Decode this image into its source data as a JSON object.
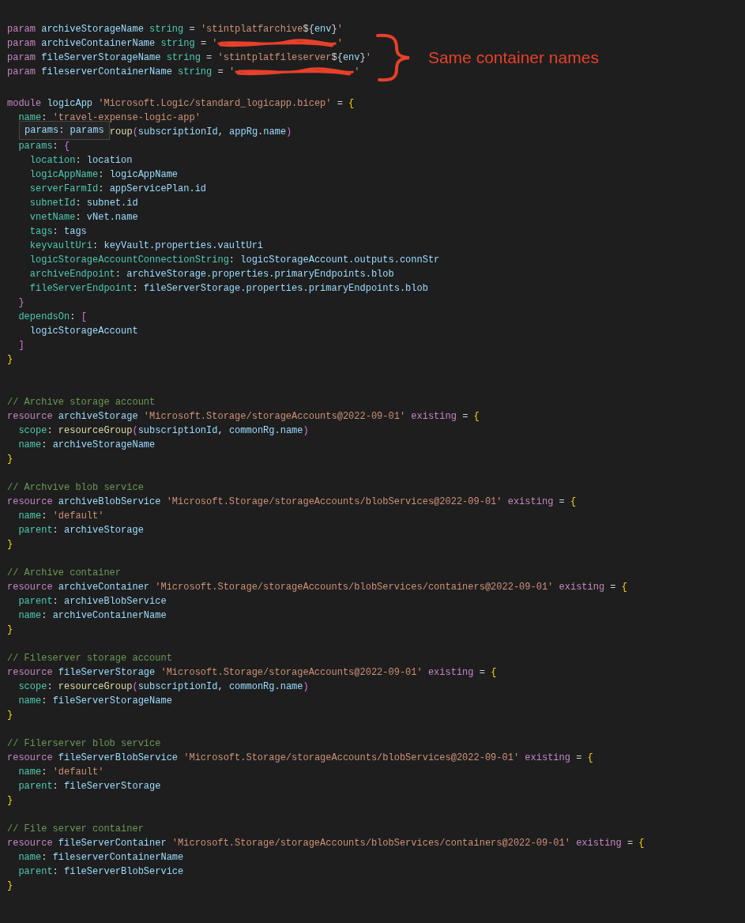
{
  "editor": {
    "blocks": [
      {
        "kind": "none",
        "lines": [
          {
            "tokens": [
              {
                "kind": "kw",
                "text": "param "
              },
              {
                "kind": "id",
                "text": "archiveStorageName "
              },
              {
                "kind": "type",
                "text": "string "
              },
              {
                "kind": "op",
                "text": "= "
              },
              {
                "kind": "str",
                "text": "'stintplatfarchive"
              },
              {
                "kind": "op",
                "text": "${"
              },
              {
                "kind": "id",
                "text": "env"
              },
              {
                "kind": "op",
                "text": "}"
              },
              {
                "kind": "str",
                "text": "'"
              }
            ]
          },
          {
            "tokens": [
              {
                "kind": "kw",
                "text": "param "
              },
              {
                "kind": "id",
                "text": "archiveContainerName "
              },
              {
                "kind": "type",
                "text": "string "
              },
              {
                "kind": "op",
                "text": "= "
              },
              {
                "kind": "str",
                "text": "'"
              },
              {
                "kind": "redacted"
              },
              {
                "kind": "str",
                "text": "'"
              }
            ]
          },
          {
            "tokens": [
              {
                "kind": "kw",
                "text": "param "
              },
              {
                "kind": "id",
                "text": "fileServerStorageName "
              },
              {
                "kind": "type",
                "text": "string "
              },
              {
                "kind": "op",
                "text": "= "
              },
              {
                "kind": "str",
                "text": "'stintplatfileserver"
              },
              {
                "kind": "op",
                "text": "${"
              },
              {
                "kind": "id",
                "text": "env"
              },
              {
                "kind": "op",
                "text": "}"
              },
              {
                "kind": "str",
                "text": "'"
              }
            ]
          },
          {
            "tokens": [
              {
                "kind": "kw",
                "text": "param "
              },
              {
                "kind": "id",
                "text": "fileserverContainerName "
              },
              {
                "kind": "type",
                "text": "string "
              },
              {
                "kind": "op",
                "text": "= "
              },
              {
                "kind": "str",
                "text": "'"
              },
              {
                "kind": "redacted"
              },
              {
                "kind": "str",
                "text": "'"
              }
            ]
          }
        ]
      },
      {
        "kind": "single",
        "lines": [
          {
            "tokens": [
              {
                "kind": "kw",
                "text": "module "
              },
              {
                "kind": "id",
                "text": "logicApp "
              },
              {
                "kind": "str",
                "text": "'Microsoft.Logic/standard_logicapp.bicep' "
              },
              {
                "kind": "op",
                "text": "= "
              },
              {
                "kind": "b1",
                "text": "{"
              }
            ]
          },
          {
            "tokens": [
              {
                "kind": "prop",
                "text": "  name"
              },
              {
                "kind": "op",
                "text": ": "
              },
              {
                "kind": "str",
                "text": "'travel-expense-logic-app'"
              }
            ]
          },
          {
            "tokens": [
              {
                "kind": "tooltip",
                "text": "params: params"
              },
              {
                "kind": "fn",
                "text": "roup"
              },
              {
                "kind": "b2",
                "text": "("
              },
              {
                "kind": "id",
                "text": "subscriptionId"
              },
              {
                "kind": "op",
                "text": ", "
              },
              {
                "kind": "id",
                "text": "appRg"
              },
              {
                "kind": "op",
                "text": "."
              },
              {
                "kind": "id",
                "text": "name"
              },
              {
                "kind": "b2",
                "text": ")"
              }
            ]
          },
          {
            "tokens": [
              {
                "kind": "prop",
                "text": "  params"
              },
              {
                "kind": "op",
                "text": ": "
              },
              {
                "kind": "b2",
                "text": "{"
              }
            ]
          },
          {
            "tokens": [
              {
                "kind": "prop",
                "text": "    location"
              },
              {
                "kind": "op",
                "text": ": "
              },
              {
                "kind": "id",
                "text": "location"
              }
            ]
          },
          {
            "tokens": [
              {
                "kind": "prop",
                "text": "    logicAppName"
              },
              {
                "kind": "op",
                "text": ": "
              },
              {
                "kind": "id",
                "text": "logicAppName"
              }
            ]
          },
          {
            "tokens": [
              {
                "kind": "prop",
                "text": "    serverFarmId"
              },
              {
                "kind": "op",
                "text": ": "
              },
              {
                "kind": "id",
                "text": "appServicePlan.id"
              }
            ]
          },
          {
            "tokens": [
              {
                "kind": "prop",
                "text": "    subnetId"
              },
              {
                "kind": "op",
                "text": ": "
              },
              {
                "kind": "id",
                "text": "subnet.id"
              }
            ]
          },
          {
            "tokens": [
              {
                "kind": "prop",
                "text": "    vnetName"
              },
              {
                "kind": "op",
                "text": ": "
              },
              {
                "kind": "id",
                "text": "vNet.name"
              }
            ]
          },
          {
            "tokens": [
              {
                "kind": "prop",
                "text": "    tags"
              },
              {
                "kind": "op",
                "text": ": "
              },
              {
                "kind": "id",
                "text": "tags"
              }
            ]
          },
          {
            "tokens": [
              {
                "kind": "prop",
                "text": "    keyvaultUri"
              },
              {
                "kind": "op",
                "text": ": "
              },
              {
                "kind": "id",
                "text": "keyVault.properties.vaultUri"
              }
            ]
          },
          {
            "tokens": [
              {
                "kind": "prop",
                "text": "    logicStorageAccountConnectionString"
              },
              {
                "kind": "op",
                "text": ": "
              },
              {
                "kind": "id",
                "text": "logicStorageAccount.outputs.connStr"
              }
            ]
          },
          {
            "tokens": [
              {
                "kind": "prop",
                "text": "    archiveEndpoint"
              },
              {
                "kind": "op",
                "text": ": "
              },
              {
                "kind": "id",
                "text": "archiveStorage.properties.primaryEndpoints.blob"
              }
            ]
          },
          {
            "tokens": [
              {
                "kind": "prop",
                "text": "    fileServerEndpoint"
              },
              {
                "kind": "op",
                "text": ": "
              },
              {
                "kind": "id",
                "text": "fileServerStorage.properties.primaryEndpoints.blob"
              }
            ]
          },
          {
            "tokens": [
              {
                "kind": "b2",
                "text": "  }"
              }
            ]
          },
          {
            "tokens": [
              {
                "kind": "prop",
                "text": "  dependsOn"
              },
              {
                "kind": "op",
                "text": ": "
              },
              {
                "kind": "b2",
                "text": "["
              }
            ]
          },
          {
            "tokens": [
              {
                "kind": "id",
                "text": "    logicStorageAccount"
              }
            ]
          },
          {
            "tokens": [
              {
                "kind": "b2",
                "text": "  ]"
              }
            ]
          },
          {
            "tokens": [
              {
                "kind": "b1",
                "text": "}"
              }
            ]
          }
        ]
      },
      {
        "kind": "double",
        "lines": [
          {
            "tokens": [
              {
                "kind": "cm",
                "text": "// Archive storage account"
              }
            ]
          },
          {
            "tokens": [
              {
                "kind": "kw",
                "text": "resource "
              },
              {
                "kind": "id",
                "text": "archiveStorage "
              },
              {
                "kind": "str",
                "text": "'Microsoft.Storage/storageAccounts@2022-09-01' "
              },
              {
                "kind": "kw",
                "text": "existing "
              },
              {
                "kind": "op",
                "text": "= "
              },
              {
                "kind": "b1",
                "text": "{"
              }
            ]
          },
          {
            "tokens": [
              {
                "kind": "prop",
                "text": "  scope"
              },
              {
                "kind": "op",
                "text": ": "
              },
              {
                "kind": "fn",
                "text": "resourceGroup"
              },
              {
                "kind": "b2",
                "text": "("
              },
              {
                "kind": "id",
                "text": "subscriptionId"
              },
              {
                "kind": "op",
                "text": ", "
              },
              {
                "kind": "id",
                "text": "commonRg.name"
              },
              {
                "kind": "b2",
                "text": ")"
              }
            ]
          },
          {
            "tokens": [
              {
                "kind": "prop",
                "text": "  name"
              },
              {
                "kind": "op",
                "text": ": "
              },
              {
                "kind": "id",
                "text": "archiveStorageName"
              }
            ]
          },
          {
            "tokens": [
              {
                "kind": "b1",
                "text": "}"
              }
            ]
          }
        ]
      },
      {
        "kind": "single",
        "lines": [
          {
            "tokens": [
              {
                "kind": "cm",
                "text": "// Archvive blob service"
              }
            ]
          },
          {
            "tokens": [
              {
                "kind": "kw",
                "text": "resource "
              },
              {
                "kind": "id",
                "text": "archiveBlobService "
              },
              {
                "kind": "str",
                "text": "'Microsoft.Storage/storageAccounts/blobServices@2022-09-01' "
              },
              {
                "kind": "kw",
                "text": "existing "
              },
              {
                "kind": "op",
                "text": "= "
              },
              {
                "kind": "b1",
                "text": "{"
              }
            ]
          },
          {
            "tokens": [
              {
                "kind": "prop",
                "text": "  name"
              },
              {
                "kind": "op",
                "text": ": "
              },
              {
                "kind": "str",
                "text": "'default'"
              }
            ]
          },
          {
            "tokens": [
              {
                "kind": "prop",
                "text": "  parent"
              },
              {
                "kind": "op",
                "text": ": "
              },
              {
                "kind": "id",
                "text": "archiveStorage"
              }
            ]
          },
          {
            "tokens": [
              {
                "kind": "b1",
                "text": "}"
              }
            ]
          }
        ]
      },
      {
        "kind": "single",
        "lines": [
          {
            "tokens": [
              {
                "kind": "cm",
                "text": "// Archive container"
              }
            ]
          },
          {
            "tokens": [
              {
                "kind": "kw",
                "text": "resource "
              },
              {
                "kind": "id",
                "text": "archiveContainer "
              },
              {
                "kind": "str",
                "text": "'Microsoft.Storage/storageAccounts/blobServices/containers@2022-09-01' "
              },
              {
                "kind": "kw",
                "text": "existing "
              },
              {
                "kind": "op",
                "text": "= "
              },
              {
                "kind": "b1",
                "text": "{"
              }
            ]
          },
          {
            "tokens": [
              {
                "kind": "prop",
                "text": "  parent"
              },
              {
                "kind": "op",
                "text": ": "
              },
              {
                "kind": "id",
                "text": "archiveBlobService"
              }
            ]
          },
          {
            "tokens": [
              {
                "kind": "prop",
                "text": "  name"
              },
              {
                "kind": "op",
                "text": ": "
              },
              {
                "kind": "id",
                "text": "archiveContainerName"
              }
            ]
          },
          {
            "tokens": [
              {
                "kind": "b1",
                "text": "}"
              }
            ]
          }
        ]
      },
      {
        "kind": "single",
        "lines": [
          {
            "tokens": [
              {
                "kind": "cm",
                "text": "// Fileserver storage account"
              }
            ]
          },
          {
            "tokens": [
              {
                "kind": "kw",
                "text": "resource "
              },
              {
                "kind": "id",
                "text": "fileServerStorage "
              },
              {
                "kind": "str",
                "text": "'Microsoft.Storage/storageAccounts@2022-09-01' "
              },
              {
                "kind": "kw",
                "text": "existing "
              },
              {
                "kind": "op",
                "text": "= "
              },
              {
                "kind": "b1",
                "text": "{"
              }
            ]
          },
          {
            "tokens": [
              {
                "kind": "prop",
                "text": "  scope"
              },
              {
                "kind": "op",
                "text": ": "
              },
              {
                "kind": "fn",
                "text": "resourceGroup"
              },
              {
                "kind": "b2",
                "text": "("
              },
              {
                "kind": "id",
                "text": "subscriptionId"
              },
              {
                "kind": "op",
                "text": ", "
              },
              {
                "kind": "id",
                "text": "commonRg.name"
              },
              {
                "kind": "b2",
                "text": ")"
              }
            ]
          },
          {
            "tokens": [
              {
                "kind": "prop",
                "text": "  name"
              },
              {
                "kind": "op",
                "text": ": "
              },
              {
                "kind": "id",
                "text": "fileServerStorageName"
              }
            ]
          },
          {
            "tokens": [
              {
                "kind": "b1",
                "text": "}"
              }
            ]
          }
        ]
      },
      {
        "kind": "single",
        "lines": [
          {
            "tokens": [
              {
                "kind": "cm",
                "text": "// Filerserver blob service"
              }
            ]
          },
          {
            "tokens": [
              {
                "kind": "kw",
                "text": "resource "
              },
              {
                "kind": "id",
                "text": "fileServerBlobService "
              },
              {
                "kind": "str",
                "text": "'Microsoft.Storage/storageAccounts/blobServices@2022-09-01' "
              },
              {
                "kind": "kw",
                "text": "existing "
              },
              {
                "kind": "op",
                "text": "= "
              },
              {
                "kind": "b1",
                "text": "{"
              }
            ]
          },
          {
            "tokens": [
              {
                "kind": "prop",
                "text": "  name"
              },
              {
                "kind": "op",
                "text": ": "
              },
              {
                "kind": "str",
                "text": "'default'"
              }
            ]
          },
          {
            "tokens": [
              {
                "kind": "prop",
                "text": "  parent"
              },
              {
                "kind": "op",
                "text": ": "
              },
              {
                "kind": "id",
                "text": "fileServerStorage"
              }
            ]
          },
          {
            "tokens": [
              {
                "kind": "b1",
                "text": "}"
              }
            ]
          }
        ]
      },
      {
        "kind": "single",
        "lines": [
          {
            "tokens": [
              {
                "kind": "cm",
                "text": "// File server container"
              }
            ]
          },
          {
            "tokens": [
              {
                "kind": "kw",
                "text": "resource "
              },
              {
                "kind": "id",
                "text": "fileServerContainer "
              },
              {
                "kind": "str",
                "text": "'Microsoft.Storage/storageAccounts/blobServices/containers@2022-09-01' "
              },
              {
                "kind": "kw",
                "text": "existing "
              },
              {
                "kind": "op",
                "text": "= "
              },
              {
                "kind": "b1",
                "text": "{"
              }
            ]
          },
          {
            "tokens": [
              {
                "kind": "prop",
                "text": "  name"
              },
              {
                "kind": "op",
                "text": ": "
              },
              {
                "kind": "id",
                "text": "fileserverContainerName"
              }
            ]
          },
          {
            "tokens": [
              {
                "kind": "prop",
                "text": "  parent"
              },
              {
                "kind": "op",
                "text": ": "
              },
              {
                "kind": "id",
                "text": "fileServerBlobService"
              }
            ]
          },
          {
            "tokens": [
              {
                "kind": "b1",
                "text": "}"
              }
            ]
          }
        ]
      }
    ]
  },
  "annotation": {
    "text": "Same container names"
  }
}
